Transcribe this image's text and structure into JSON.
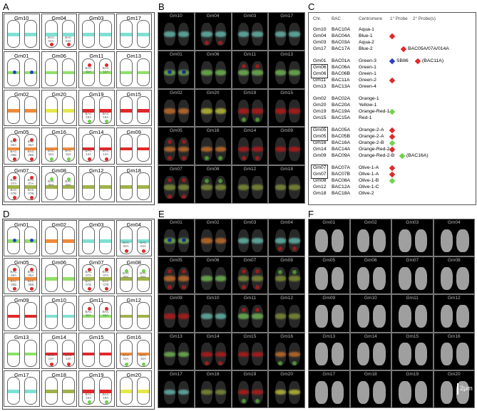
{
  "panels": {
    "A": "A",
    "B": "B",
    "C": "C",
    "D": "D",
    "E": "E",
    "F": "F"
  },
  "panelA": [
    [
      "Gm10",
      "Gm04",
      "Gm03",
      "Gm17"
    ],
    [
      "Gm01",
      "Gm06",
      "Gm11",
      "Gm13"
    ],
    [
      "Gm02",
      "Gm20",
      "Gm19",
      "Gm15"
    ],
    [
      "Gm05",
      "Gm16",
      "Gm14",
      "Gm09"
    ],
    [
      "Gm07",
      "Gm08",
      "Gm12",
      "Gm18"
    ]
  ],
  "panelD": [
    [
      "Gm01",
      "Gm02",
      "Gm03",
      "Gm04"
    ],
    [
      "Gm05",
      "Gm06",
      "Gm07",
      "Gm08"
    ],
    [
      "Gm09",
      "Gm10",
      "Gm11",
      "Gm12"
    ],
    [
      "Gm13",
      "Gm14",
      "Gm15",
      "Gm16"
    ],
    [
      "Gm17",
      "Gm18",
      "Gm19",
      "Gm20"
    ]
  ],
  "bac_labels": {
    "a_gm04": "BAC 04A",
    "a_gm11": "BAC 11A",
    "a_gm19": "BAC 19A",
    "a_gm05_top": "BAC 05A",
    "a_gm05_bot": "BAC 05B",
    "a_gm16": "BAC 16A",
    "a_gm14": "BAC 14A",
    "a_gm07_top": "BAC 07A",
    "a_gm07_bot": "BAC 07B",
    "a_gm08": "BAC 08A",
    "d_gm04": "BAC 04A",
    "d_gm05_top": "BAC 05A",
    "d_gm05_bot": "BAC 05B",
    "d_gm07_top": "BAC 07A",
    "d_gm07_bot": "BAC 07B",
    "d_gm08": "BAC 08A",
    "d_gm11": "BAC 11A",
    "d_gm14": "BAC 14A",
    "d_gm16": "BAC 16A",
    "d_gm19": "BAC 19A"
  },
  "table": {
    "headers": {
      "chr": "Chr.",
      "bac": "BAC",
      "centromere": "Centromere",
      "probe1": "1° Probe",
      "probe2": "2° Probe(s)"
    },
    "groups": [
      {
        "rows": [
          {
            "chr": "Gm10",
            "bac": "BAC10A",
            "cen": "Aqua-1",
            "p1": "",
            "p2": ""
          },
          {
            "chr": "Gm04",
            "bac": "BAC04A",
            "cen": "Blue-1",
            "p1": "red",
            "p2": ""
          },
          {
            "chr": "Gm03",
            "bac": "BAC03A",
            "cen": "Aqua-2",
            "p1": "",
            "p2": ""
          },
          {
            "chr": "Gm17",
            "bac": "BAC17A",
            "cen": "Blue-2",
            "p1": "",
            "p2": "BAC05A/07A/014A"
          }
        ]
      },
      {
        "rows": [
          {
            "chr": "Gm01",
            "bac": "BAC01A",
            "cen": "Green-3",
            "p1": "blue",
            "p1text": "SB86",
            "p2": "(BAC11A)"
          },
          {
            "chr": "Gm06",
            "bac": "BAC06A",
            "cen": "Green-1",
            "p1": "",
            "p2": "",
            "boxed": true
          },
          {
            "chr": "Gm06",
            "bac": "BAC06B",
            "cen": "Green-1",
            "p1": "",
            "p2": "",
            "boxed": true
          },
          {
            "chr": "Gm11",
            "bac": "BAC11A",
            "cen": "Green-2",
            "p1": "red",
            "p2": ""
          },
          {
            "chr": "Gm13",
            "bac": "BAC13A",
            "cen": "Green-4",
            "p1": "",
            "p2": ""
          }
        ]
      },
      {
        "rows": [
          {
            "chr": "Gm02",
            "bac": "BAC02A",
            "cen": "Orange-1",
            "p1": "",
            "p2": ""
          },
          {
            "chr": "Gm20",
            "bac": "BAC20A",
            "cen": "Yellow-1",
            "p1": "",
            "p2": ""
          },
          {
            "chr": "Gm19",
            "bac": "BAC19A",
            "cen": "Orange-Red-1",
            "p1": "green",
            "p2": ""
          },
          {
            "chr": "Gm15",
            "bac": "BAC15A",
            "cen": "Red-1",
            "p1": "",
            "p2": ""
          }
        ]
      },
      {
        "rows": [
          {
            "chr": "Gm05",
            "bac": "BAC05A",
            "cen": "Orange-2-A",
            "p1": "red",
            "p2": "",
            "boxed": true
          },
          {
            "chr": "Gm05",
            "bac": "BAC05B",
            "cen": "Orange-2-A",
            "p1": "red",
            "p2": "",
            "boxed": true
          },
          {
            "chr": "Gm16",
            "bac": "BAC16A",
            "cen": "Orange-2-B",
            "p1": "green",
            "p2": ""
          },
          {
            "chr": "Gm14",
            "bac": "BAC14A",
            "cen": "Orange-Red-2-A",
            "p1": "red",
            "p2": ""
          },
          {
            "chr": "Gm09",
            "bac": "BAC09A",
            "cen": "Orange-Red-2-B",
            "p1": "",
            "p2": "(BAC16A)"
          }
        ]
      },
      {
        "rows": [
          {
            "chr": "Gm07",
            "bac": "BAC07A",
            "cen": "Olive-1-A",
            "p1": "red",
            "p2": "",
            "boxed": true
          },
          {
            "chr": "Gm07",
            "bac": "BAC07B",
            "cen": "Olive-1-A",
            "p1": "red",
            "p2": "",
            "boxed": true
          },
          {
            "chr": "Gm08",
            "bac": "BAC08A",
            "cen": "Olive-1-B",
            "p1": "green",
            "p2": ""
          },
          {
            "chr": "Gm12",
            "bac": "BAC12A",
            "cen": "Olive-1-C",
            "p1": "",
            "p2": ""
          },
          {
            "chr": "Gm18",
            "bac": "BAC18A",
            "cen": "Olive-2",
            "p1": "",
            "p2": ""
          }
        ]
      }
    ]
  },
  "scale_bar": "2μm",
  "colors": {
    "red": "#e0282a",
    "green": "#6fd34a",
    "blue": "#2a3fc9",
    "aqua": "#7fe0d2",
    "orange": "#f08a3a",
    "yellow": "#e6e84a",
    "olive": "#9fb24a",
    "greenband": "#8fe06a"
  }
}
